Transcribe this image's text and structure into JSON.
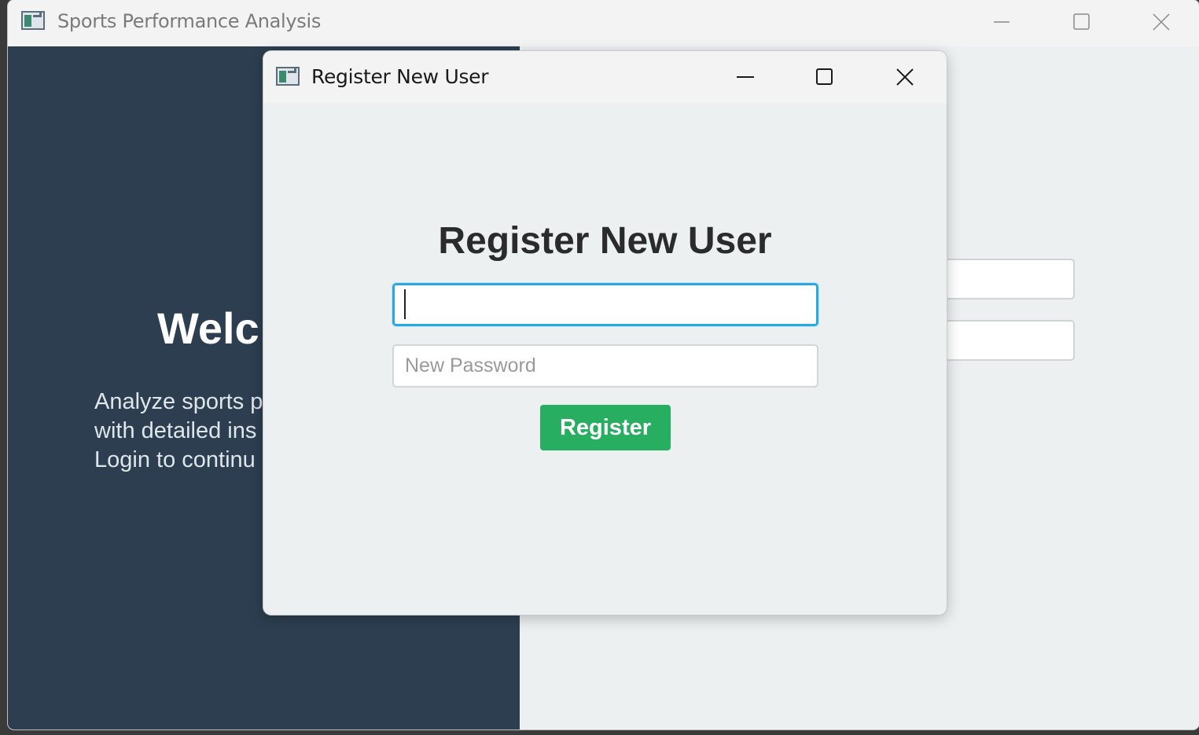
{
  "main_window": {
    "title": "Sports Performance Analysis",
    "welcome_heading": "Welc",
    "welcome_lines": [
      "Analyze sports p",
      "with detailed ins",
      "Login to continu"
    ],
    "bg_fragment": ""
  },
  "dialog": {
    "title": "Register New User",
    "heading": "Register New User",
    "username": {
      "value": "",
      "placeholder": ""
    },
    "password": {
      "value": "",
      "placeholder": "New Password"
    },
    "register_label": "Register"
  },
  "colors": {
    "left_panel": "#2c3e50",
    "background": "#ecf0f1",
    "register_button": "#27ae60",
    "focus_border": "#29a9e0"
  },
  "icons": {
    "app_icon": "app-window-icon",
    "minimize": "minimize-icon",
    "maximize": "maximize-icon",
    "close": "close-icon"
  }
}
